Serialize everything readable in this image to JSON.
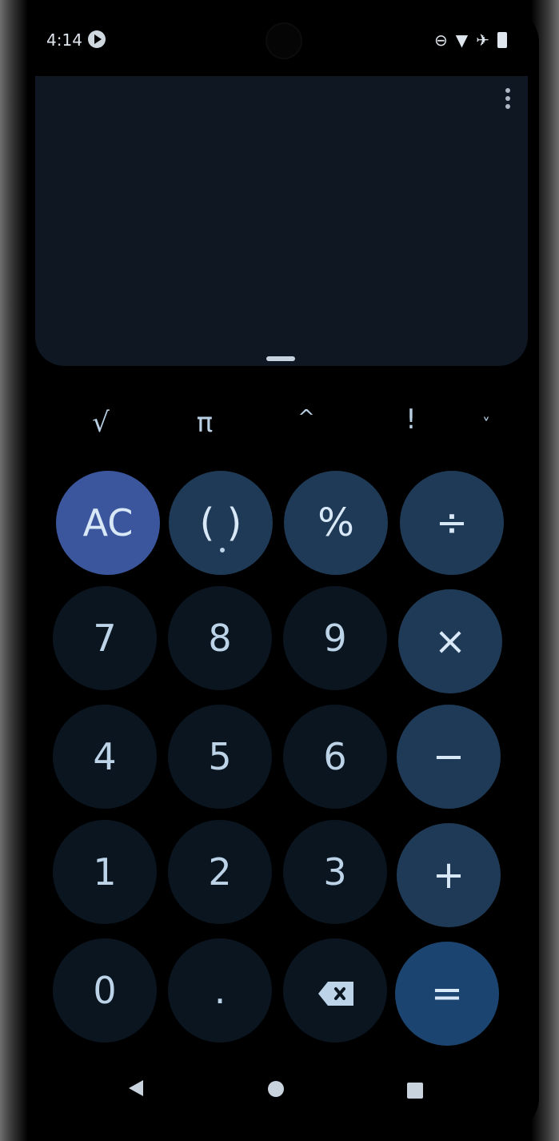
{
  "status_bar": {
    "time": "4:14",
    "icons": [
      "media-playing-icon",
      "do-not-disturb-icon",
      "wifi-icon",
      "airplane-icon",
      "battery-icon"
    ]
  },
  "display": {
    "expression": "",
    "result": ""
  },
  "scientific_row": {
    "sqrt": "√",
    "pi": "π",
    "power": "^",
    "factorial": "!",
    "expand": "˅"
  },
  "keypad": {
    "clear": "AC",
    "parentheses": "( )",
    "percent": "%",
    "divide": "÷",
    "multiply": "×",
    "minus": "−",
    "plus": "+",
    "equals": "=",
    "seven": "7",
    "eight": "8",
    "nine": "9",
    "four": "4",
    "five": "5",
    "six": "6",
    "one": "1",
    "two": "2",
    "three": "3",
    "zero": "0",
    "decimal": "."
  },
  "colors": {
    "background": "#000000",
    "display": "#0e1722",
    "clear_button": "#3b569c",
    "operator_button": "#1f3a56",
    "number_button": "#0a1520",
    "equals_button": "#1b4570",
    "text": "#d9e8f7"
  },
  "navigation": {
    "icons": [
      "back-icon",
      "home-icon",
      "recents-icon"
    ]
  }
}
